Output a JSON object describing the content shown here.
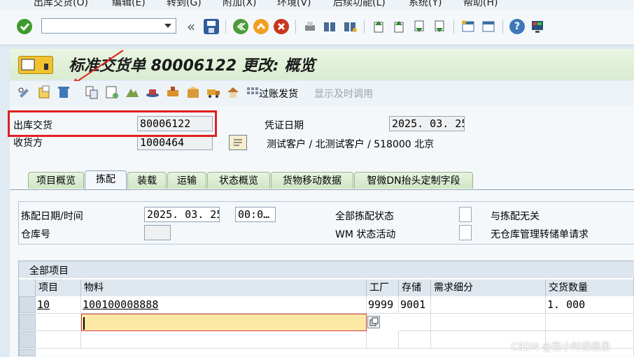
{
  "menubar": {
    "items": [
      "出库交货(O)",
      "编辑(E)",
      "转到(G)",
      "附加(X)",
      "环境(V)",
      "后续功能(L)",
      "系统(Y)",
      "帮助(H)"
    ]
  },
  "toolbar": {
    "command_field_value": "",
    "icons": [
      "enter-icon",
      "back-icon",
      "save-icon",
      "back-green-icon",
      "exit-icon",
      "cancel-icon",
      "print-icon",
      "find-icon",
      "find-next-icon",
      "first-page-icon",
      "prev-page-icon",
      "next-page-icon",
      "last-page-icon",
      "new-session-icon",
      "shortcut-icon",
      "help-icon",
      "customize-icon"
    ]
  },
  "title": "标准交货单 80006122 更改: 概览",
  "app_toolbar": {
    "icons": [
      "display-change-icon",
      "other-delivery-icon",
      "delete-icon",
      "document-flow-icon",
      "status-icon",
      "mountain-icon",
      "hat-icon",
      "stamp-icon",
      "box-icon",
      "truck-icon",
      "house-icon",
      "grid-icon"
    ],
    "post_goods_issue": "过账发货",
    "display_call": "显示及时调用"
  },
  "header": {
    "outbound_delivery_label": "出库交货",
    "outbound_delivery_value": "80006122",
    "ship_to_label": "收货方",
    "ship_to_value": "1000464",
    "doc_date_label": "凭证日期",
    "doc_date_value": "2025. 03. 25",
    "ship_to_desc": "测试客户 / 北测试客户 / 518000 北京"
  },
  "tabs": [
    "项目概览",
    "拣配",
    "装载",
    "运输",
    "状态概览",
    "货物移动数据",
    "智微DN抬头定制字段"
  ],
  "active_tab": "拣配",
  "picking": {
    "pick_date_label": "拣配日期/时间",
    "pick_date_value": "2025. 03. 25",
    "pick_time_value": "00:0…",
    "warehouse_label": "仓库号",
    "warehouse_value": "",
    "overall_pick_status_label": "全部拣配状态",
    "wm_status_label": "WM 状态活动",
    "not_relevant_label": "与拣配无关",
    "no_wm_transfer_label": "无仓库管理转储单请求"
  },
  "table": {
    "title": "全部项目",
    "columns": [
      "项目",
      "物料",
      "工厂",
      "存储",
      "需求细分",
      "交货数量"
    ],
    "rows": [
      {
        "item": "10",
        "material": "100100008888",
        "plant": "9999",
        "sloc": "9001",
        "req": "",
        "qty": "1. 000"
      }
    ]
  },
  "watermark": "CSDN @我小时候很黑"
}
